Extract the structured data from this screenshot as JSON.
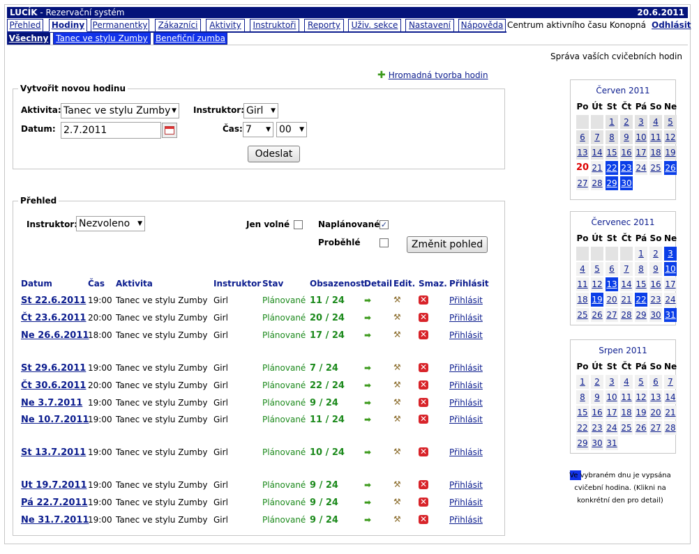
{
  "header": {
    "app_name": "LUCÍK",
    "app_subtitle": " - Rezervační systém",
    "date": "20.6.2011"
  },
  "nav": {
    "tabs": [
      "Přehled",
      "Hodiny",
      "Permanentky",
      "Zákazníci",
      "Aktivity",
      "Instruktoři",
      "Reporty",
      "Uživ. sekce",
      "Nastavení",
      "Nápověda"
    ],
    "center_name": "Centrum aktivního času Konopná",
    "logout": "Odhlásit",
    "subtabs": [
      "Všechny",
      "Tanec ve stylu Zumby",
      "Benefiční zumba"
    ]
  },
  "page": {
    "subtitle": "Správa vaších cvičebních hodin",
    "bulk_link": "Hromadná tvorba hodin"
  },
  "create": {
    "legend": "Vytvořit novou hodinu",
    "activity_label": "Aktivita:",
    "activity_value": "Tanec ve stylu Zumby",
    "instructor_label": "Instruktor:",
    "instructor_value": "Girl",
    "date_label": "Datum:",
    "date_value": "2.7.2011",
    "time_label": "Čas:",
    "hour_value": "7",
    "minute_value": "00",
    "submit": "Odeslat"
  },
  "overview": {
    "legend": "Přehled",
    "instructor_label": "Instruktor:",
    "instructor_value": "Nezvoleno",
    "free_only": "Jen volné",
    "planned": "Naplánované",
    "past": "Proběhlé",
    "change_view": "Změnit pohled",
    "columns": [
      "Datum",
      "Čas",
      "Aktivita",
      "Instruktor",
      "Stav",
      "Obsazenost",
      "Detail",
      "Edit.",
      "Smaz.",
      "Přihlásit"
    ],
    "rows": [
      {
        "date": "St 22.6.2011",
        "time": "19:00",
        "activity": "Tanec ve stylu Zumby",
        "instructor": "Girl",
        "state": "Plánované",
        "occ": "11 / 24",
        "sign": "Přihlásit"
      },
      {
        "date": "Čt 23.6.2011",
        "time": "20:00",
        "activity": "Tanec ve stylu Zumby",
        "instructor": "Girl",
        "state": "Plánované",
        "occ": "20 / 24",
        "sign": "Přihlásit"
      },
      {
        "date": "Ne 26.6.2011",
        "time": "18:00",
        "activity": "Tanec ve stylu Zumby",
        "instructor": "Girl",
        "state": "Plánované",
        "occ": "17 / 24",
        "sign": "Přihlásit"
      },
      {
        "date": "St 29.6.2011",
        "time": "19:00",
        "activity": "Tanec ve stylu Zumby",
        "instructor": "Girl",
        "state": "Plánované",
        "occ": "7 / 24",
        "sign": "Přihlásit"
      },
      {
        "date": "Čt 30.6.2011",
        "time": "20:00",
        "activity": "Tanec ve stylu Zumby",
        "instructor": "Girl",
        "state": "Plánované",
        "occ": "22 / 24",
        "sign": "Přihlásit"
      },
      {
        "date": "Ne 3.7.2011",
        "time": "19:00",
        "activity": "Tanec ve stylu Zumby",
        "instructor": "Girl",
        "state": "Plánované",
        "occ": "9 / 24",
        "sign": "Přihlásit"
      },
      {
        "date": "Ne 10.7.2011",
        "time": "19:00",
        "activity": "Tanec ve stylu Zumby",
        "instructor": "Girl",
        "state": "Plánované",
        "occ": "11 / 24",
        "sign": "Přihlásit"
      },
      {
        "date": "St 13.7.2011",
        "time": "19:00",
        "activity": "Tanec ve stylu Zumby",
        "instructor": "Girl",
        "state": "Plánované",
        "occ": "10 / 24",
        "sign": "Přihlásit"
      },
      {
        "date": "Ut 19.7.2011",
        "time": "19:00",
        "activity": "Tanec ve stylu Zumby",
        "instructor": "Girl",
        "state": "Plánované",
        "occ": "9 / 24",
        "sign": "Přihlásit"
      },
      {
        "date": "Pá 22.7.2011",
        "time": "19:00",
        "activity": "Tanec ve stylu Zumby",
        "instructor": "Girl",
        "state": "Plánované",
        "occ": "9 / 24",
        "sign": "Přihlásit"
      },
      {
        "date": "Ne 31.7.2011",
        "time": "19:00",
        "activity": "Tanec ve stylu Zumby",
        "instructor": "Girl",
        "state": "Plánované",
        "occ": "9 / 24",
        "sign": "Přihlásit"
      }
    ]
  },
  "calendars": {
    "weekdays": [
      "Po",
      "Út",
      "St",
      "Čt",
      "Pá",
      "So",
      "Ne"
    ],
    "months": [
      {
        "title": "Červen 2011",
        "first_weekday": 2,
        "days": 30,
        "today": 20,
        "events": [
          22,
          23,
          26,
          29,
          30
        ]
      },
      {
        "title": "Červenec 2011",
        "first_weekday": 4,
        "days": 31,
        "today": null,
        "events": [
          3,
          10,
          13,
          19,
          22,
          31
        ]
      },
      {
        "title": "Srpen 2011",
        "first_weekday": 0,
        "days": 31,
        "today": null,
        "events": []
      }
    ]
  },
  "legend_text": "Ve vybraném dnu je vypsána cvičební hodina. (Klikni na konkrétní den pro detail)",
  "icons": {
    "detail": "arrow-right-icon",
    "edit": "hammer-icon",
    "delete": "delete-x-icon",
    "calendar": "calendar-icon",
    "add": "plus-icon"
  },
  "colors": {
    "primary": "#04137a",
    "link": "#0b1c8e",
    "event_day": "#0a3ee8",
    "status_green": "#1c8a1c",
    "today_red": "#d00000"
  }
}
